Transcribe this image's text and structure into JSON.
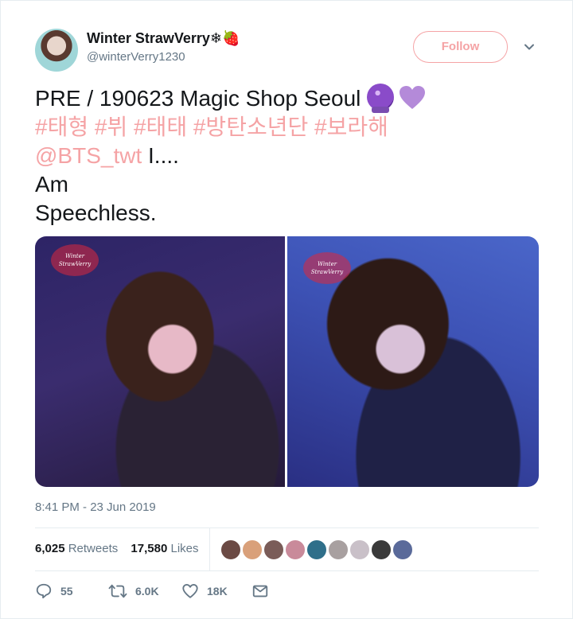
{
  "author": {
    "display_name": "Winter StrawVerry",
    "name_emojis": "❄🍓",
    "handle": "@winterVerry1230",
    "avatar_icon": "user-avatar"
  },
  "follow_button": {
    "label": "Follow"
  },
  "tweet": {
    "text_line1": "PRE / 190623 Magic Shop Seoul",
    "hashtags": "#태형 #뷔 #태태 #방탄소년단 #보라해",
    "mention": "@BTS_twt",
    "text_after_mention": " I....",
    "text_line4": "Am",
    "text_line5": "Speechless."
  },
  "media": {
    "watermark_text": "Winter StrawVerry"
  },
  "timestamp": "8:41 PM - 23 Jun 2019",
  "stats": {
    "retweets_count": "6,025",
    "retweets_label": "Retweets",
    "likes_count": "17,580",
    "likes_label": "Likes"
  },
  "liker_avatars": [
    {
      "color": "#6b4a44"
    },
    {
      "color": "#d9a07a"
    },
    {
      "color": "#7a5c58"
    },
    {
      "color": "#c98a9a"
    },
    {
      "color": "#2f6f8a"
    },
    {
      "color": "#a8a0a0"
    },
    {
      "color": "#c9c0c8"
    },
    {
      "color": "#3a3a3a"
    },
    {
      "color": "#5a6a9a"
    }
  ],
  "actions": {
    "reply_count": "55",
    "retweet_count": "6.0K",
    "like_count": "18K"
  },
  "colors": {
    "accent": "#f5a3a5",
    "text": "#14171a",
    "muted": "#657786"
  }
}
